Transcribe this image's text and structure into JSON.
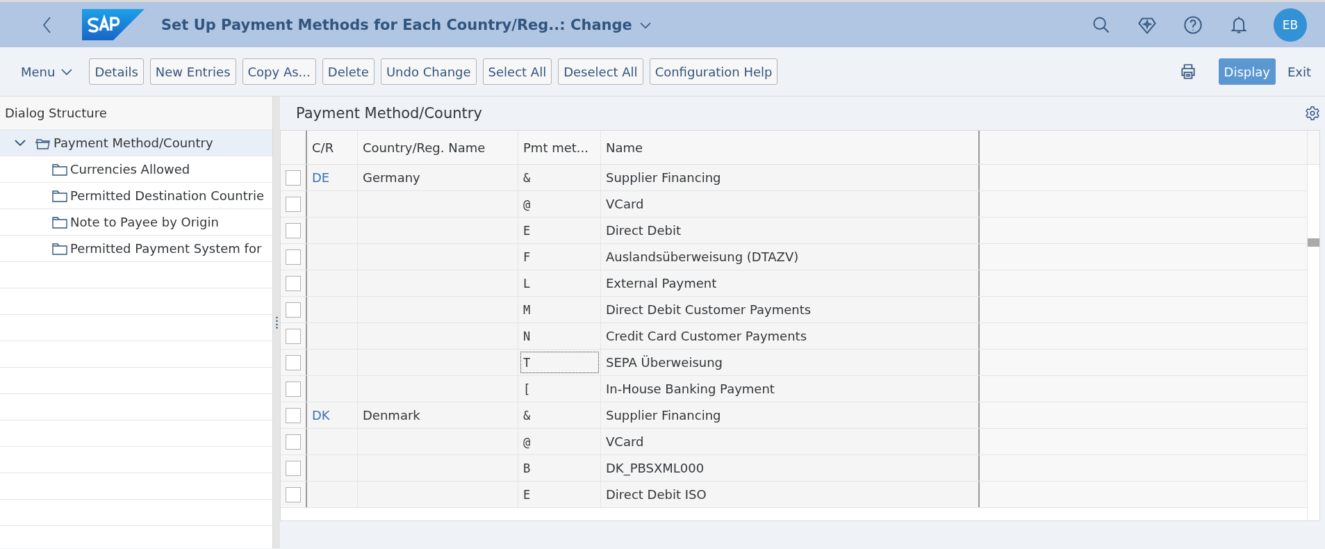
{
  "shell_bar": {
    "title": "Set Up Payment Methods for Each Country/Reg..: Change",
    "avatar": "EB"
  },
  "toolbar": {
    "items": [
      {
        "label": "Menu",
        "kind": "menu"
      },
      {
        "label": "Details",
        "kind": "button"
      },
      {
        "label": "New Entries",
        "kind": "button"
      },
      {
        "label": "Copy As...",
        "kind": "button"
      },
      {
        "label": "Delete",
        "kind": "button"
      },
      {
        "label": "Undo Change",
        "kind": "button"
      },
      {
        "label": "Select All",
        "kind": "button"
      },
      {
        "label": "Deselect All",
        "kind": "button"
      },
      {
        "label": "Configuration Help",
        "kind": "button"
      }
    ],
    "right_items": [
      {
        "label": "Display",
        "kind": "emphasized"
      },
      {
        "label": "Exit",
        "kind": "plain"
      }
    ]
  },
  "dialog_structure": {
    "title": "Dialog Structure",
    "tree": [
      {
        "label": "Payment Method/Country",
        "expanded": true,
        "selected": true,
        "children": [
          {
            "label": "Currencies Allowed",
            "selected": false
          },
          {
            "label": "Permitted Destination Countrie",
            "selected": false
          },
          {
            "label": "Note to Payee by Origin",
            "selected": false
          },
          {
            "label": "Permitted Payment System for",
            "selected": false
          }
        ]
      }
    ]
  },
  "table": {
    "title": "Payment Method/Country",
    "columns": [
      "C/R",
      "Country/Reg. Name",
      "Pmt met...",
      "Name"
    ],
    "rows": [
      {
        "checked": false,
        "cr": "DE",
        "country": "Germany",
        "pmt": "&",
        "name": "Supplier Financing",
        "focused": false
      },
      {
        "checked": false,
        "pmt": "@",
        "name": "VCard",
        "focused": false
      },
      {
        "checked": false,
        "pmt": "E",
        "name": "Direct Debit",
        "focused": false
      },
      {
        "checked": false,
        "pmt": "F",
        "name": "Auslandsüberweisung (DTAZV)",
        "focused": false
      },
      {
        "checked": false,
        "pmt": "L",
        "name": "External Payment",
        "focused": false
      },
      {
        "checked": false,
        "pmt": "M",
        "name": "Direct Debit Customer Payments",
        "focused": false
      },
      {
        "checked": false,
        "pmt": "N",
        "name": "Credit Card Customer Payments",
        "focused": false
      },
      {
        "checked": false,
        "pmt": "T",
        "name": "SEPA Überweisung",
        "focused": true
      },
      {
        "checked": false,
        "pmt": "[",
        "name": "In-House Banking Payment",
        "focused": false
      },
      {
        "checked": false,
        "cr": "DK",
        "country": "Denmark",
        "pmt": "&",
        "name": "Supplier Financing",
        "focused": false
      },
      {
        "checked": false,
        "pmt": "@",
        "name": "VCard",
        "focused": false
      },
      {
        "checked": false,
        "pmt": "B",
        "name": "DK_PBSXML000",
        "focused": false
      },
      {
        "checked": false,
        "pmt": "E",
        "name": "Direct Debit ISO",
        "focused": false
      }
    ]
  }
}
